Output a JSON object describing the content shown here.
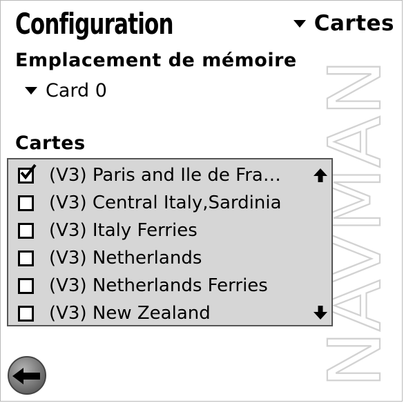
{
  "header": {
    "title": "Configuration",
    "category_selector": "Cartes"
  },
  "memory": {
    "section_label": "Emplacement de mémoire",
    "selected": "Card 0"
  },
  "maps": {
    "section_label": "Cartes",
    "items": [
      {
        "label": "(V3) Paris and Ile de Fra…",
        "checked": true
      },
      {
        "label": "(V3) Central Italy,Sardinia",
        "checked": false
      },
      {
        "label": "(V3) Italy Ferries",
        "checked": false
      },
      {
        "label": "(V3) Netherlands",
        "checked": false
      },
      {
        "label": "(V3) Netherlands Ferries",
        "checked": false
      },
      {
        "label": "(V3) New Zealand",
        "checked": false
      }
    ]
  },
  "watermark": "NAVMAN",
  "icons": {
    "dropdown": "triangle-down-icon",
    "checkbox": "checkbox-icon",
    "checkmark": "checkmark-icon",
    "scroll_up": "arrow-up-icon",
    "scroll_down": "arrow-down-icon",
    "back": "back-arrow-icon"
  },
  "colors": {
    "list_background": "#d6d6d6",
    "watermark": "#dcdcdc",
    "back_button": "#707070"
  }
}
